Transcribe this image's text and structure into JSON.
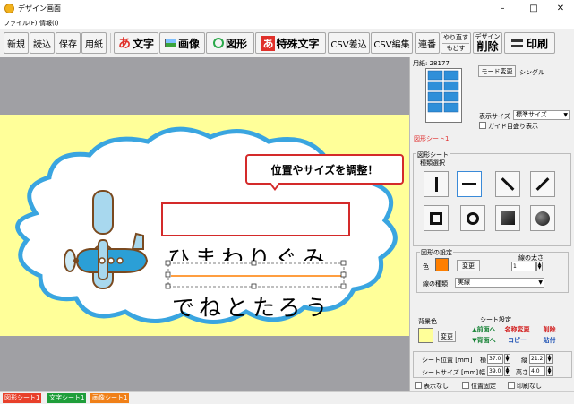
{
  "window": {
    "title": "デザイン画面",
    "minimize": "–",
    "maximize": "□",
    "close": "✕"
  },
  "menu": [
    "ファイル(F)",
    "情報(I)"
  ],
  "toolbar": {
    "new": "新規",
    "open": "読込",
    "save": "保存",
    "paper": "用紙",
    "text": "文字",
    "image": "画像",
    "shape": "図形",
    "special_text": "特殊文字",
    "csv_insert": "CSV差込",
    "csv_edit": "CSV編集",
    "serial": "連番",
    "redo": "やり直す",
    "undo": "もどす",
    "delete_top": "デザイン",
    "delete": "削除",
    "print": "印刷"
  },
  "canvas": {
    "text_line1": "ひまわりぐみ",
    "text_line2": "でねとたろう",
    "callout": "位置やサイズを調整！"
  },
  "right_panel": {
    "paper_info": "用紙: 28177",
    "mode_change": "モード変更",
    "mode": "シングル",
    "display_size_label": "表示サイズ",
    "display_size_value": "標準サイズ",
    "guide_label": "ガイド目盛り表示",
    "sheet_title": "図形シート1",
    "shape_sheet_group": "図形シート",
    "shape_kind_label": "種類選択",
    "shape_settings_group": "図形の設定",
    "color_label": "色",
    "color_change": "変更",
    "line_width_label": "線の太さ",
    "line_width_value": "1",
    "line_type_label": "線の種類",
    "line_type_value": "実線",
    "bg_color_label": "背景色",
    "bg_change": "変更",
    "sheet_settings_label": "シート設定",
    "to_front": "▲前面へ",
    "to_back": "▼背面へ",
    "rename": "名称変更",
    "copy": "コピー",
    "delete": "削除",
    "paste": "貼付",
    "pos_label": "シート位置 [mm]",
    "x_label": "横",
    "x_value": "37.0",
    "y_label": "縦",
    "y_value": "21.2",
    "size_label": "シートサイズ [mm]",
    "w_label": "幅",
    "w_value": "39.0",
    "h_label": "高さ",
    "h_value": "4.0",
    "hide_label": "表示なし",
    "lock_label": "位置固定",
    "noprint_label": "印刷なし",
    "colors": {
      "shape_color": "#ff7f00",
      "bg_color": "#ffff99",
      "sheet_title_color": "#e03030",
      "front_back_color": "#0f7f2f",
      "edit_color": "#d22020",
      "copy_color": "#1a4fb3"
    }
  },
  "tabs": [
    {
      "label": "図形シート1",
      "color": "#e8402a"
    },
    {
      "label": "文字シート1",
      "color": "#1f9e3a"
    },
    {
      "label": "画像シート1",
      "color": "#f08018"
    }
  ]
}
